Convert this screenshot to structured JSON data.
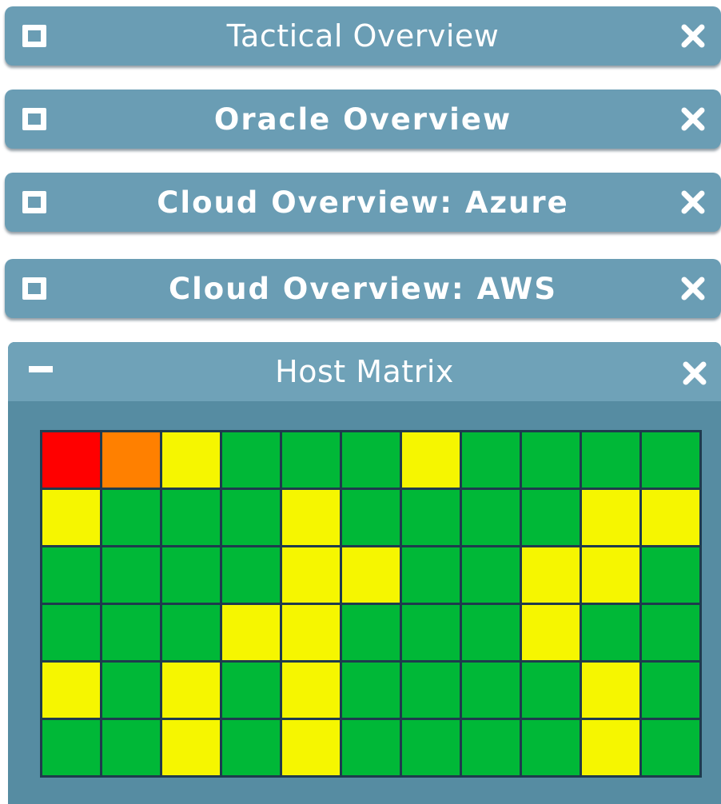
{
  "panels": [
    {
      "id": "p1",
      "title": "Tactical Overview",
      "state": "collapsed"
    },
    {
      "id": "p2",
      "title": "Oracle Overview",
      "state": "collapsed"
    },
    {
      "id": "p3",
      "title": "Cloud Overview: Azure",
      "state": "collapsed"
    },
    {
      "id": "p4",
      "title": "Cloud Overview: AWS",
      "state": "collapsed"
    },
    {
      "id": "p5",
      "title": "Host Matrix",
      "state": "expanded"
    }
  ],
  "icons": {
    "restore": "restore-icon",
    "minimize": "minimize-icon",
    "close": "close-icon"
  },
  "status_colors": {
    "critical": "#ff0000",
    "major": "#ff8000",
    "warning": "#f6f600",
    "ok": "#00b837"
  },
  "host_matrix": {
    "rows": 6,
    "columns": 11,
    "cells": [
      [
        "critical",
        "major",
        "warning",
        "ok",
        "ok",
        "ok",
        "warning",
        "ok",
        "ok",
        "ok",
        "ok"
      ],
      [
        "warning",
        "ok",
        "ok",
        "ok",
        "warning",
        "ok",
        "ok",
        "ok",
        "ok",
        "warning",
        "warning"
      ],
      [
        "ok",
        "ok",
        "ok",
        "ok",
        "warning",
        "warning",
        "ok",
        "ok",
        "warning",
        "warning",
        "ok"
      ],
      [
        "ok",
        "ok",
        "ok",
        "warning",
        "warning",
        "ok",
        "ok",
        "ok",
        "warning",
        "ok",
        "ok"
      ],
      [
        "warning",
        "ok",
        "warning",
        "ok",
        "warning",
        "ok",
        "ok",
        "ok",
        "ok",
        "warning",
        "ok"
      ],
      [
        "ok",
        "ok",
        "warning",
        "ok",
        "warning",
        "ok",
        "ok",
        "ok",
        "ok",
        "warning",
        "ok"
      ]
    ]
  }
}
